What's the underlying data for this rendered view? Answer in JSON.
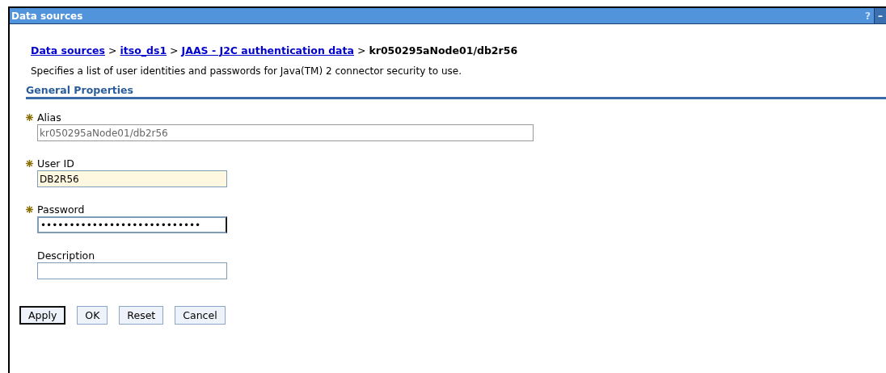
{
  "window": {
    "title": "Data sources",
    "buttons": [
      {
        "kind": "help",
        "label": "?"
      },
      {
        "kind": "minimize",
        "label": "–"
      }
    ]
  },
  "breadcrumb": [
    {
      "label": "Data sources",
      "link": true
    },
    {
      "label": "itso_ds1",
      "link": true
    },
    {
      "label": "JAAS - J2C authentication data",
      "link": true
    },
    {
      "label": "kr050295aNode01/db2r56",
      "link": false
    }
  ],
  "separator": ">",
  "description": "Specifies a list of user identities and passwords for Java(TM) 2 connector security to use.",
  "section": "General Properties",
  "fields": [
    {
      "label": "Alias",
      "required": true,
      "value": "kr050295aNode01/db2r56",
      "disabled": true,
      "highlighted": false,
      "focused": false,
      "kind": "wide"
    },
    {
      "label": "User ID",
      "required": true,
      "value": "DB2R56",
      "disabled": false,
      "highlighted": true,
      "focused": false,
      "kind": "narrow"
    },
    {
      "label": "Password",
      "required": true,
      "value": "••••••••••••••••••••••••••••",
      "disabled": false,
      "highlighted": false,
      "focused": true,
      "kind": "narrow"
    },
    {
      "label": "Description",
      "required": false,
      "disabled": false,
      "highlighted": false,
      "focused": false,
      "kind": "narrow"
    }
  ],
  "buttons": [
    {
      "label": "Apply",
      "default": true
    },
    {
      "label": "OK",
      "default": false
    },
    {
      "label": "Reset",
      "default": false
    },
    {
      "label": "Cancel",
      "default": false
    }
  ]
}
